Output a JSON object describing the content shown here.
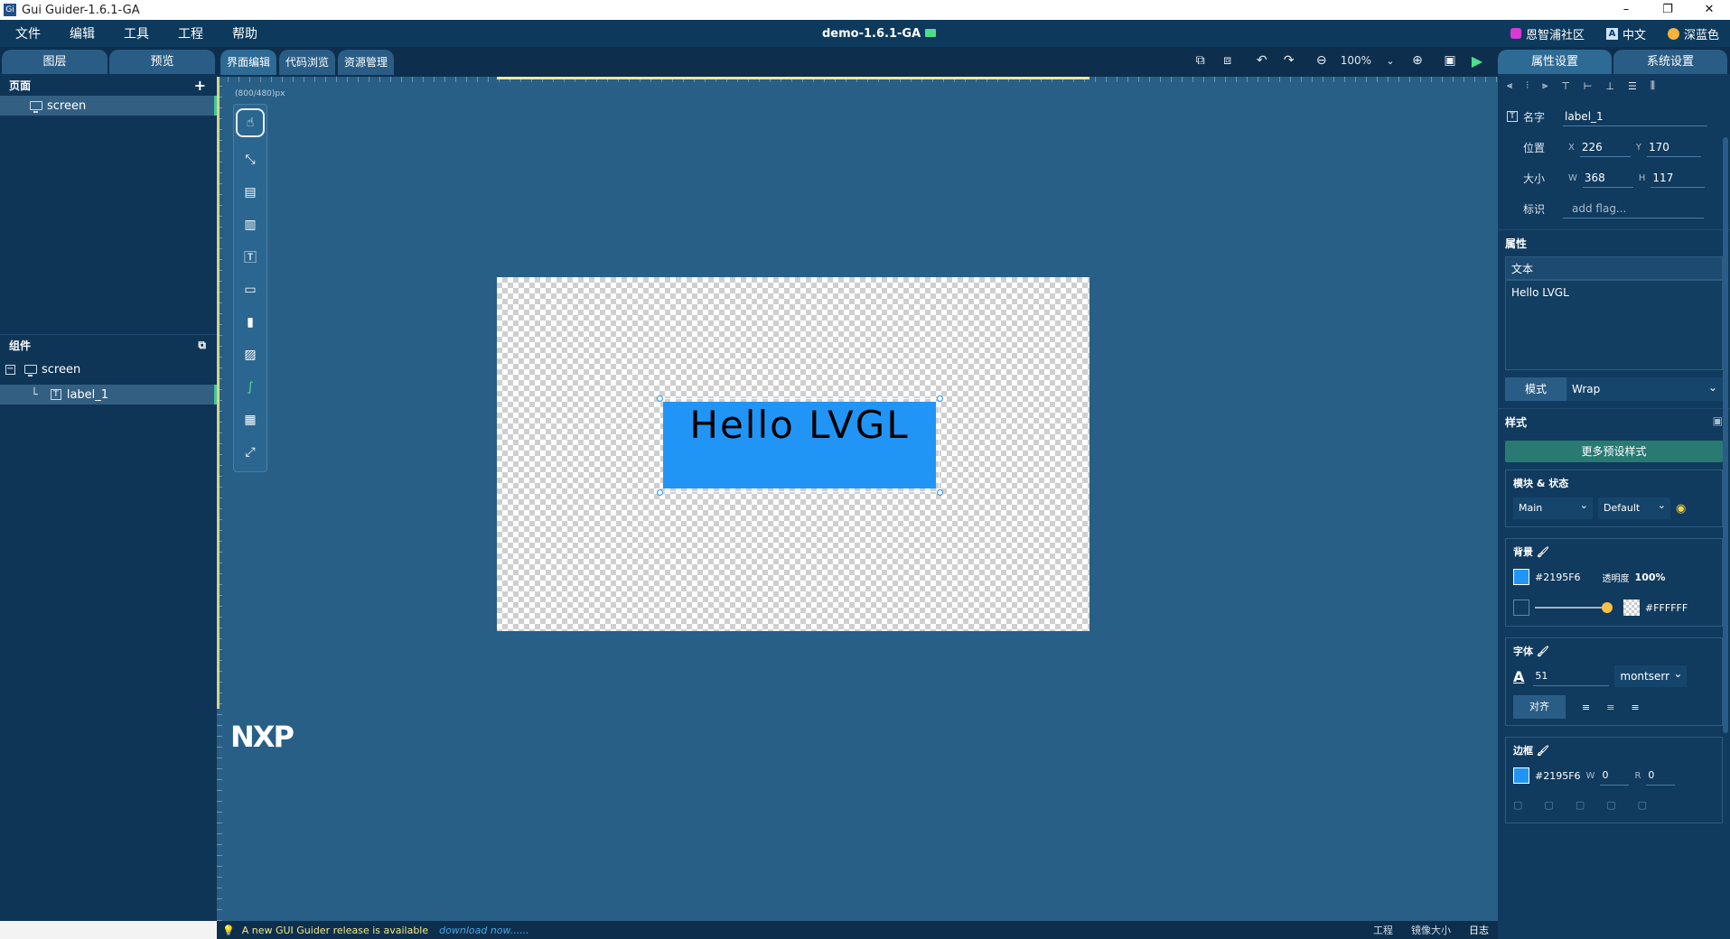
{
  "window": {
    "title": "Gui Guider-1.6.1-GA",
    "controls": [
      "–",
      "❐",
      "✕"
    ]
  },
  "menu": {
    "items": [
      "文件",
      "编辑",
      "工具",
      "工程",
      "帮助"
    ],
    "project_title": "demo-1.6.1-GA",
    "community": "恩智浦社区",
    "language": "中文",
    "theme": "深蓝色"
  },
  "left_panel": {
    "tabs": [
      "图层",
      "预览"
    ],
    "pages_title": "页面",
    "pages": [
      "screen"
    ],
    "widgets_title": "组件",
    "tree": {
      "root": "screen",
      "child": "label_1"
    }
  },
  "main_tabs": [
    "界面编辑",
    "代码浏览",
    "资源管理"
  ],
  "toolbar": {
    "zoom": "100%"
  },
  "canvas": {
    "size_hint": "(800/480)px",
    "label_text": "Hello LVGL",
    "label_bg": "#2195F6",
    "logo": "NXP"
  },
  "status": {
    "message": "A new GUI Guider release is available",
    "link": "download now......",
    "items": [
      "工程",
      "镜像大小",
      "日志"
    ]
  },
  "right_panel": {
    "tabs": [
      "属性设置",
      "系统设置"
    ],
    "name_label": "名字",
    "name_value": "label_1",
    "pos_label": "位置",
    "x": "226",
    "y": "170",
    "size_label": "大小",
    "w": "368",
    "h": "117",
    "flag_label": "标识",
    "flag_placeholder": "add flag...",
    "attr_title": "属性",
    "text_head": "文本",
    "text_value": "Hello LVGL",
    "mode_label": "模式",
    "mode_value": "Wrap",
    "style_title": "样式",
    "preset_button": "更多预设样式",
    "part_state_title": "模块 & 状态",
    "part": "Main",
    "state": "Default",
    "bg_title": "背景",
    "bg_color": "#2195F6",
    "opacity_label": "透明度",
    "opacity_value": "100%",
    "grad_color": "#FFFFFF",
    "font_title": "字体",
    "font_size": "51",
    "font_name": "montserr",
    "align_label": "对齐",
    "border_title": "边框",
    "border_color": "#2195F6",
    "border_w_label": "W",
    "border_w": "0",
    "border_r_label": "R",
    "border_r": "0"
  }
}
